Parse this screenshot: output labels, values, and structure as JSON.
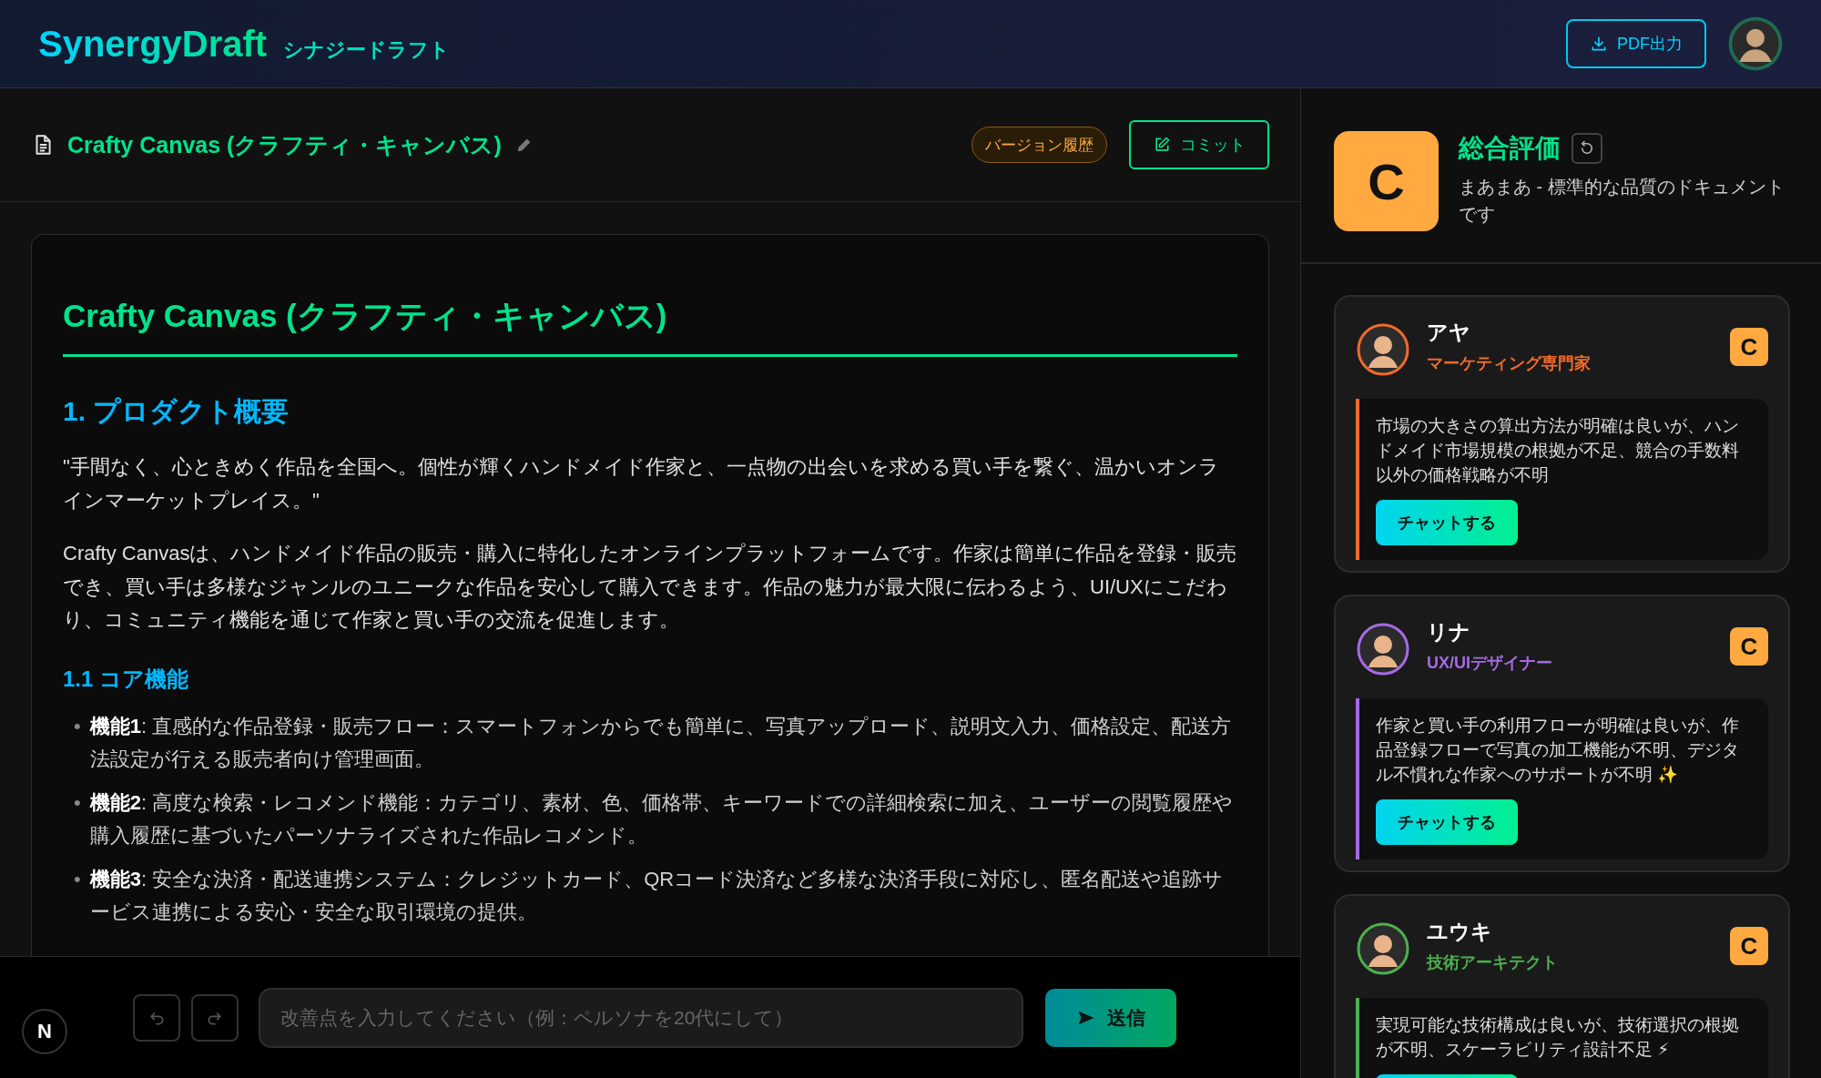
{
  "header": {
    "logo": "SynergyDraft",
    "logo_sub": "シナジードラフト",
    "export_button": "PDF出力"
  },
  "document_bar": {
    "title": "Crafty Canvas (クラフティ・キャンバス)",
    "history_button": "バージョン履歴",
    "commit_button": "コミット"
  },
  "document": [
    {
      "kind": "h1",
      "text": "Crafty Canvas (クラフティ・キャンバス)"
    },
    {
      "kind": "h2",
      "text": "1. プロダクト概要"
    },
    {
      "kind": "p",
      "text": "\"手間なく、心ときめく作品を全国へ。個性が輝くハンドメイド作家と、一点物の出会いを求める買い手を繋ぐ、温かいオンラインマーケットプレイス。\""
    },
    {
      "kind": "p",
      "text": "Crafty Canvasは、ハンドメイド作品の販売・購入に特化したオンラインプラットフォームです。作家は簡単に作品を登録・販売でき、買い手は多様なジャンルのユニークな作品を安心して購入できます。作品の魅力が最大限に伝わるよう、UI/UXにこだわり、コミュニティ機能を通じて作家と買い手の交流を促進します。"
    },
    {
      "kind": "h3",
      "text": "1.1 コア機能"
    },
    {
      "kind": "list",
      "bullet": "•",
      "items": [
        "**機能1**: 直感的な作品登録・販売フロー：スマートフォンからでも簡単に、写真アップロード、説明文入力、価格設定、配送方法設定が行える販売者向け管理画面。",
        "**機能2**: 高度な検索・レコメンド機能：カテゴリ、素材、色、価格帯、キーワードでの詳細検索に加え、ユーザーの閲覧履歴や購入履歴に基づいたパーソナライズされた作品レコメンド。",
        "**機能3**: 安全な決済・配送連携システム：クレジットカード、QRコード決済など多様な決済手段に対応し、匿名配送や追跡サービス連携による安心・安全な取引環境の提供。"
      ]
    }
  ],
  "composer": {
    "logo": "N",
    "placeholder": "改善点を入力してください（例：ペルソナを20代にして）",
    "send_button": "送信"
  },
  "overall": {
    "grade": "C",
    "title": "総合評価",
    "summary": "まあまあ - 標準的な品質のドキュメントです"
  },
  "personas": [
    {
      "name": "アヤ",
      "role": "マーケティング専門家",
      "color": "#f06a2c",
      "grade": "C",
      "comment": "市場の大きさの算出方法が明確は良いが、ハンドメイド市場規模の根拠が不足、競合の手数料以外の価格戦略が不明",
      "chat_button": "チャットする"
    },
    {
      "name": "リナ",
      "role": "UX/UIデザイナー",
      "color": "#a66ae6",
      "grade": "C",
      "comment": "作家と買い手の利用フローが明確は良いが、作品登録フローで写真の加工機能が不明、デジタル不慣れな作家へのサポートが不明 ✨",
      "chat_button": "チャットする"
    },
    {
      "name": "ユウキ",
      "role": "技術アーキテクト",
      "color": "#4caf50",
      "grade": "C",
      "comment": "実現可能な技術構成は良いが、技術選択の根拠が不明、スケーラビリティ設計不足 ⚡"
    }
  ]
}
